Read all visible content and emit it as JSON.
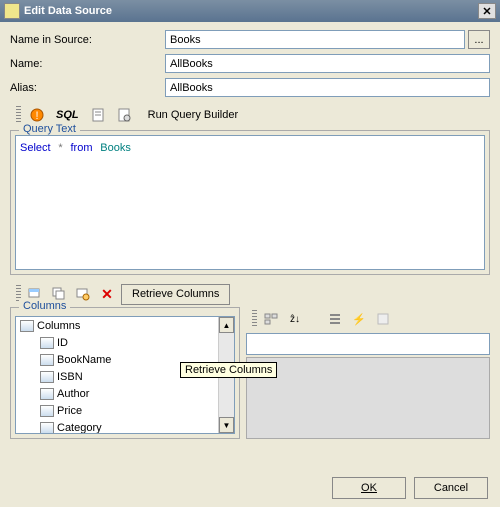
{
  "window": {
    "title": "Edit Data Source",
    "close_icon": "✕"
  },
  "form": {
    "name_in_source_label": "Name in Source:",
    "name_in_source_value": "Books",
    "ellipsis": "...",
    "name_label": "Name:",
    "name_value": "AllBooks",
    "alias_label": "Alias:",
    "alias_value": "AllBooks"
  },
  "toolbar": {
    "sql_label": "SQL",
    "run_query_builder": "Run Query Builder",
    "icons": {
      "warning": "warning-icon",
      "sql": "sql-icon",
      "doc": "doc-icon",
      "props": "props-icon"
    }
  },
  "query": {
    "legend": "Query Text",
    "kw_select": "Select",
    "star": "*",
    "kw_from": "from",
    "ident": "Books"
  },
  "columns_toolbar": {
    "retrieve_label": "Retrieve Columns",
    "tooltip": "Retrieve Columns",
    "delete": "✕"
  },
  "columns_panel": {
    "legend": "Columns",
    "root": "Columns",
    "items": [
      "ID",
      "BookName",
      "ISBN",
      "Author",
      "Price",
      "Category"
    ]
  },
  "right_toolbar": {
    "sort_label": "ẑ↓",
    "bolt": "⚡"
  },
  "footer": {
    "ok": "OK",
    "cancel": "Cancel"
  }
}
